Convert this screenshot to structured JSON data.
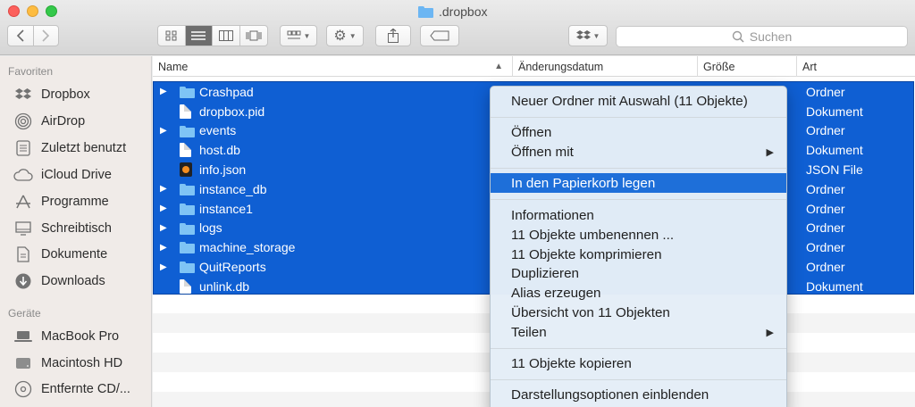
{
  "window": {
    "title": ".dropbox"
  },
  "toolbar": {
    "search_placeholder": "Suchen",
    "icons": [
      "chevron-left-icon",
      "chevron-right-icon",
      "icon-view-icon",
      "list-view-icon",
      "column-view-icon",
      "coverflow-view-icon",
      "group-icon",
      "gear-icon",
      "share-icon",
      "tag-icon",
      "dropbox-icon",
      "search-icon"
    ]
  },
  "sidebar": {
    "favorites_label": "Favoriten",
    "favorites": [
      {
        "label": "Dropbox",
        "icon": "dropbox-icon"
      },
      {
        "label": "AirDrop",
        "icon": "airdrop-icon"
      },
      {
        "label": "Zuletzt benutzt",
        "icon": "recents-icon"
      },
      {
        "label": "iCloud Drive",
        "icon": "cloud-icon"
      },
      {
        "label": "Programme",
        "icon": "applications-icon"
      },
      {
        "label": "Schreibtisch",
        "icon": "desktop-icon"
      },
      {
        "label": "Dokumente",
        "icon": "documents-icon"
      },
      {
        "label": "Downloads",
        "icon": "downloads-icon"
      }
    ],
    "devices_label": "Geräte",
    "devices": [
      {
        "label": "MacBook Pro",
        "icon": "laptop-icon"
      },
      {
        "label": "Macintosh HD",
        "icon": "harddisk-icon"
      },
      {
        "label": "Entfernte CD/...",
        "icon": "disc-icon"
      }
    ]
  },
  "columns": {
    "name": "Name",
    "date": "Änderungsdatum",
    "size": "Größe",
    "kind": "Art"
  },
  "files": [
    {
      "name": "Crashpad",
      "kind": "Ordner",
      "type": "folder"
    },
    {
      "name": "dropbox.pid",
      "kind": "Dokument",
      "type": "document"
    },
    {
      "name": "events",
      "kind": "Ordner",
      "type": "folder"
    },
    {
      "name": "host.db",
      "kind": "Dokument",
      "type": "document"
    },
    {
      "name": "info.json",
      "kind": "JSON File",
      "type": "json"
    },
    {
      "name": "instance_db",
      "kind": "Ordner",
      "type": "folder"
    },
    {
      "name": "instance1",
      "kind": "Ordner",
      "type": "folder"
    },
    {
      "name": "logs",
      "kind": "Ordner",
      "type": "folder"
    },
    {
      "name": "machine_storage",
      "kind": "Ordner",
      "type": "folder"
    },
    {
      "name": "QuitReports",
      "kind": "Ordner",
      "type": "folder"
    },
    {
      "name": "unlink.db",
      "kind": "Dokument",
      "type": "document"
    }
  ],
  "context_menu": {
    "items": [
      "Neuer Ordner mit Auswahl (11 Objekte)",
      "Öffnen",
      "Öffnen mit",
      "In den Papierkorb legen",
      "Informationen",
      "11 Objekte umbenennen ...",
      "11 Objekte komprimieren",
      "Duplizieren",
      "Alias erzeugen",
      "Übersicht von 11 Objekten",
      "Teilen",
      "11 Objekte kopieren",
      "Darstellungsoptionen einblenden"
    ],
    "highlighted": "In den Papierkorb legen"
  },
  "colors": {
    "selection": "#0f5fd3",
    "menu_highlight": "#1e6fd9"
  }
}
